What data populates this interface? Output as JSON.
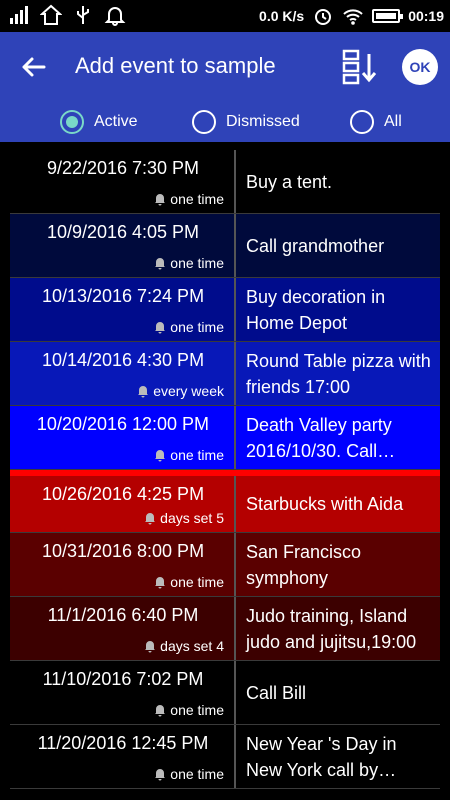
{
  "status_bar": {
    "network_speed": "0.0 K/s",
    "time": "00:19"
  },
  "app_bar": {
    "title": "Add event to sample",
    "ok_label": "OK"
  },
  "filters": [
    {
      "label": "Active",
      "selected": true
    },
    {
      "label": "Dismissed",
      "selected": false
    },
    {
      "label": "All",
      "selected": false
    }
  ],
  "events": [
    {
      "date": "9/22/2016 7:30 PM",
      "repeat": "one time",
      "title": "Buy a tent.",
      "bg": "#000000"
    },
    {
      "date": "10/9/2016 4:05 PM",
      "repeat": "one time",
      "title": "Call grandmother",
      "bg": "#000a3c"
    },
    {
      "date": "10/13/2016 7:24 PM",
      "repeat": "one time",
      "title": "Buy decoration in Home Depot",
      "bg": "#000c8c"
    },
    {
      "date": "10/14/2016 4:30 PM",
      "repeat": "every week",
      "title": "Round Table pizza with friends 17:00",
      "bg": "#0818b8"
    },
    {
      "date": "10/20/2016 12:00 PM",
      "repeat": "one time",
      "title": "Death Valley party 2016/10/30. Call…",
      "bg": "#0000ff"
    },
    {
      "date": "10/26/2016 4:25 PM",
      "repeat": "days set 5",
      "title": "Starbucks with Aida",
      "bg": "#b40000"
    },
    {
      "date": "10/31/2016 8:00 PM",
      "repeat": "one time",
      "title": "San Francisco symphony",
      "bg": "#5a0000"
    },
    {
      "date": "11/1/2016 6:40 PM",
      "repeat": "days set 4",
      "title": "Judo training, Island judo and jujitsu,19:00",
      "bg": "#3c0000"
    },
    {
      "date": "11/10/2016 7:02 PM",
      "repeat": "one time",
      "title": "Call Bill",
      "bg": "#000000"
    },
    {
      "date": "11/20/2016 12:45 PM",
      "repeat": "one time",
      "title": "New Year 's Day in New York call by…",
      "bg": "#000000"
    }
  ]
}
